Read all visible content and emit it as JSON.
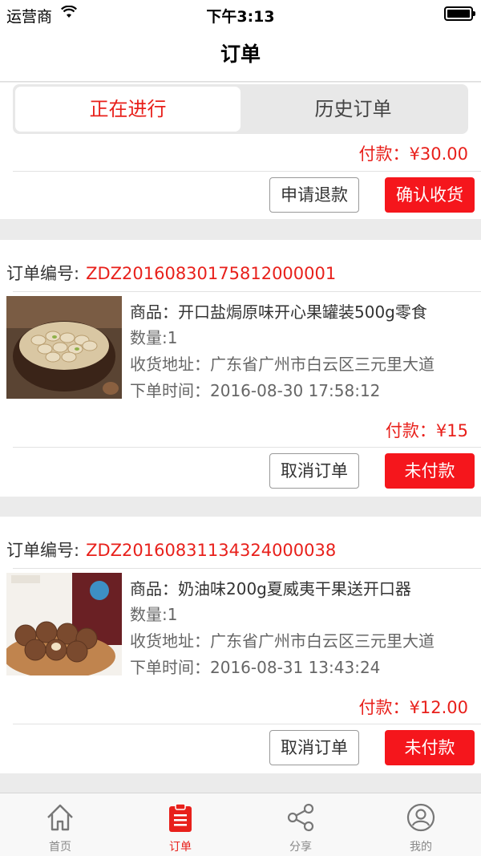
{
  "status": {
    "carrier": "运营商",
    "time": "下午3:13"
  },
  "nav": {
    "title": "订单"
  },
  "segment": {
    "active": "正在进行",
    "inactive": "历史订单"
  },
  "partial_order": {
    "payment": "付款：¥30.00",
    "refund_label": "申请退款",
    "confirm_label": "确认收货"
  },
  "orders": [
    {
      "label": "订单编号:",
      "number": "ZDZ20160830175812000001",
      "product": "商品：开口盐焗原味开心果罐装500g零食",
      "qty": "数量:1",
      "address": "收货地址：广东省广州市白云区三元里大道",
      "time": "下单时间：2016-08-30 17:58:12",
      "payment": "付款：¥15",
      "cancel_label": "取消订单",
      "pay_label": "未付款"
    },
    {
      "label": "订单编号:",
      "number": "ZDZ20160831134324000038",
      "product": "商品：奶油味200g夏威夷干果送开口器",
      "qty": "数量:1",
      "address": "收货地址：广东省广州市白云区三元里大道",
      "time": "下单时间：2016-08-31 13:43:24",
      "payment": "付款：¥12.00",
      "cancel_label": "取消订单",
      "pay_label": "未付款"
    }
  ],
  "tabbar": [
    {
      "label": "首页",
      "icon": "home-icon"
    },
    {
      "label": "订单",
      "icon": "clipboard-icon",
      "active": true
    },
    {
      "label": "分享",
      "icon": "share-icon"
    },
    {
      "label": "我的",
      "icon": "user-icon"
    }
  ],
  "colors": {
    "accent": "#e8201b",
    "button_red": "#f5161c",
    "background": "#ebebeb"
  }
}
